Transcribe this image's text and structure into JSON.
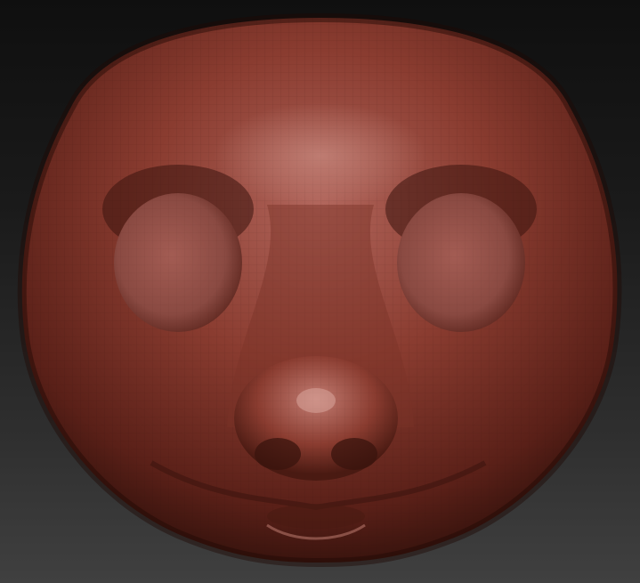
{
  "viewport": {
    "background_top": "#0f0f0f",
    "background_bottom": "#404040"
  },
  "sculpt": {
    "subject": "stylized-animal-head",
    "material_color": "#8a3c30",
    "material_highlight": "#c8867a",
    "material_shadow": "#3a140e",
    "wireframe_visible": true
  }
}
